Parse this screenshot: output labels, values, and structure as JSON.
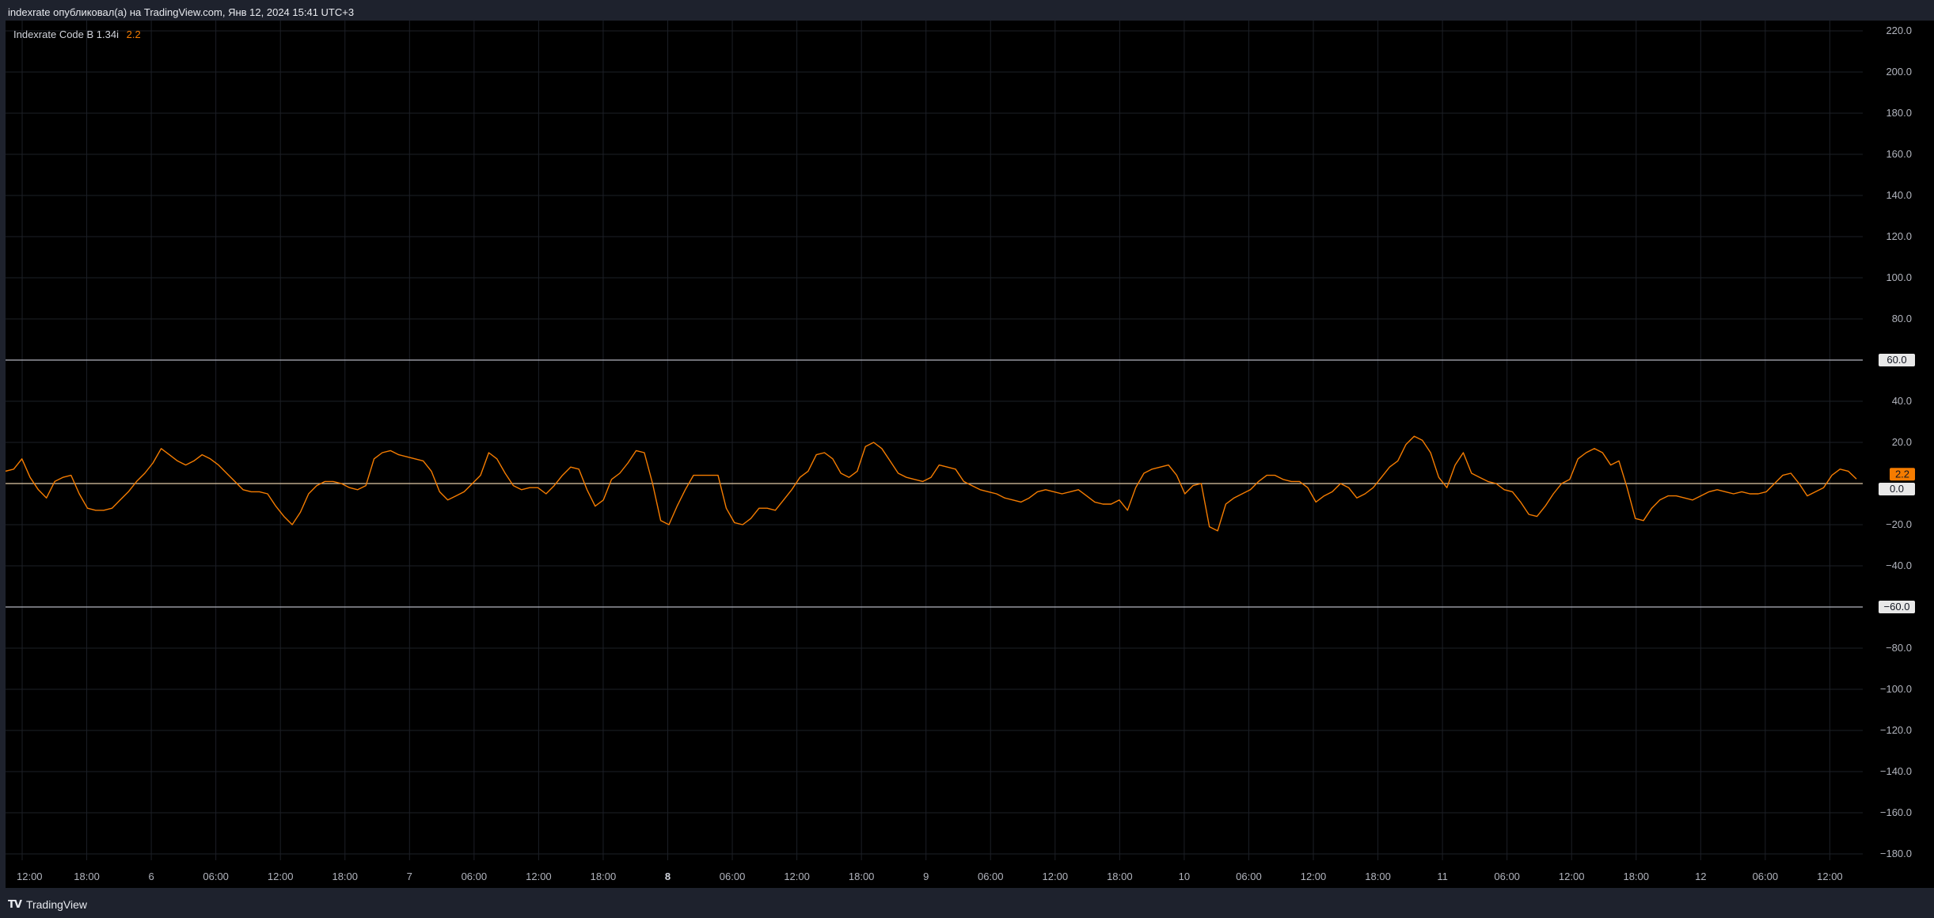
{
  "header": {
    "publish_text": "indexrate опубликовал(а) на TradingView.com, Янв 12, 2024 15:41 UTC+3"
  },
  "legend": {
    "indicator_name": "Indexrate Code B 1.34i",
    "indicator_value": "2.2"
  },
  "footer": {
    "brand": "TradingView"
  },
  "colors": {
    "background": "#000000",
    "frame": "#1e222d",
    "grid": "#1c1f26",
    "series": "#f57c00",
    "level_line": "#b2b5be",
    "zero_line": "#e0c9a6"
  },
  "chart_data": {
    "type": "line",
    "title": "",
    "xlabel": "",
    "ylabel": "",
    "ylim": [
      -190,
      222
    ],
    "grid": true,
    "y_ticks": [
      "220.0",
      "200.0",
      "180.0",
      "160.0",
      "140.0",
      "120.0",
      "100.0",
      "80.0",
      "40.0",
      "20.0",
      "−20.0",
      "−40.0",
      "−80.0",
      "−100.0",
      "−120.0",
      "−140.0",
      "−160.0",
      "−180.0"
    ],
    "y_tick_values": [
      220,
      200,
      180,
      160,
      140,
      120,
      100,
      80,
      40,
      20,
      -20,
      -40,
      -80,
      -100,
      -120,
      -140,
      -160,
      -180
    ],
    "x_ticks": [
      "12:00",
      "18:00",
      "6",
      "06:00",
      "12:00",
      "18:00",
      "7",
      "06:00",
      "12:00",
      "18:00",
      "8",
      "06:00",
      "12:00",
      "18:00",
      "9",
      "06:00",
      "12:00",
      "18:00",
      "10",
      "06:00",
      "12:00",
      "18:00",
      "11",
      "06:00",
      "12:00",
      "18:00",
      "12",
      "06:00",
      "12:00"
    ],
    "x_tick_bold": [
      false,
      false,
      false,
      false,
      false,
      false,
      false,
      false,
      false,
      false,
      true,
      false,
      false,
      false,
      false,
      false,
      false,
      false,
      false,
      false,
      false,
      false,
      false,
      false,
      false,
      false,
      false,
      false,
      false
    ],
    "levels": [
      {
        "label": "60.0",
        "value": 60
      },
      {
        "label": "0.0",
        "value": 0
      },
      {
        "label": "−60.0",
        "value": -60
      }
    ],
    "last_value_label": "2.2",
    "last_value": 2.2,
    "series": [
      {
        "values": [
          6,
          7,
          12,
          3,
          -3,
          -7,
          1,
          3,
          4,
          -5,
          -12,
          -13,
          -13,
          -12,
          -8,
          -4,
          1,
          5,
          10,
          17,
          14,
          11,
          9,
          11,
          14,
          12,
          9,
          5,
          1,
          -3,
          -4,
          -4,
          -5,
          -11,
          -16,
          -20,
          -14,
          -5,
          -1,
          1,
          1,
          0,
          -2,
          -3,
          -1,
          12,
          15,
          16,
          14,
          13,
          12,
          11,
          6,
          -4,
          -8,
          -6,
          -4,
          0,
          4,
          15,
          12,
          5,
          -1,
          -3,
          -2,
          -2,
          -5,
          -1,
          4,
          8,
          7,
          -3,
          -11,
          -8,
          2,
          5,
          10,
          16,
          15,
          0,
          -18,
          -20,
          -11,
          -3,
          4,
          4,
          4,
          4,
          -12,
          -19,
          -20,
          -17,
          -12,
          -12,
          -13,
          -8,
          -3,
          3,
          6,
          14,
          15,
          12,
          5,
          3,
          6,
          18,
          20,
          17,
          11,
          5,
          3,
          2,
          1,
          3,
          9,
          8,
          7,
          1,
          -1,
          -3,
          -4,
          -5,
          -7,
          -8,
          -9,
          -7,
          -4,
          -3,
          -4,
          -5,
          -4,
          -3,
          -6,
          -9,
          -10,
          -10,
          -8,
          -13,
          -2,
          5,
          7,
          8,
          9,
          4,
          -5,
          -1,
          0,
          -21,
          -23,
          -10,
          -7,
          -5,
          -3,
          1,
          4,
          4,
          2,
          1,
          1,
          -2,
          -9,
          -6,
          -4,
          0,
          -2,
          -7,
          -5,
          -2,
          3,
          8,
          11,
          19,
          23,
          21,
          15,
          3,
          -2,
          9,
          15,
          5,
          3,
          1,
          0,
          -3,
          -4,
          -9,
          -15,
          -16,
          -11,
          -5,
          0,
          2,
          12,
          15,
          17,
          15,
          9,
          11,
          -2,
          -17,
          -18,
          -12,
          -8,
          -6,
          -6,
          -7,
          -8,
          -6,
          -4,
          -3,
          -4,
          -5,
          -4,
          -5,
          -5,
          -4,
          0,
          4,
          5,
          0,
          -6,
          -4,
          -2,
          4,
          7,
          6,
          2.2
        ]
      }
    ]
  }
}
